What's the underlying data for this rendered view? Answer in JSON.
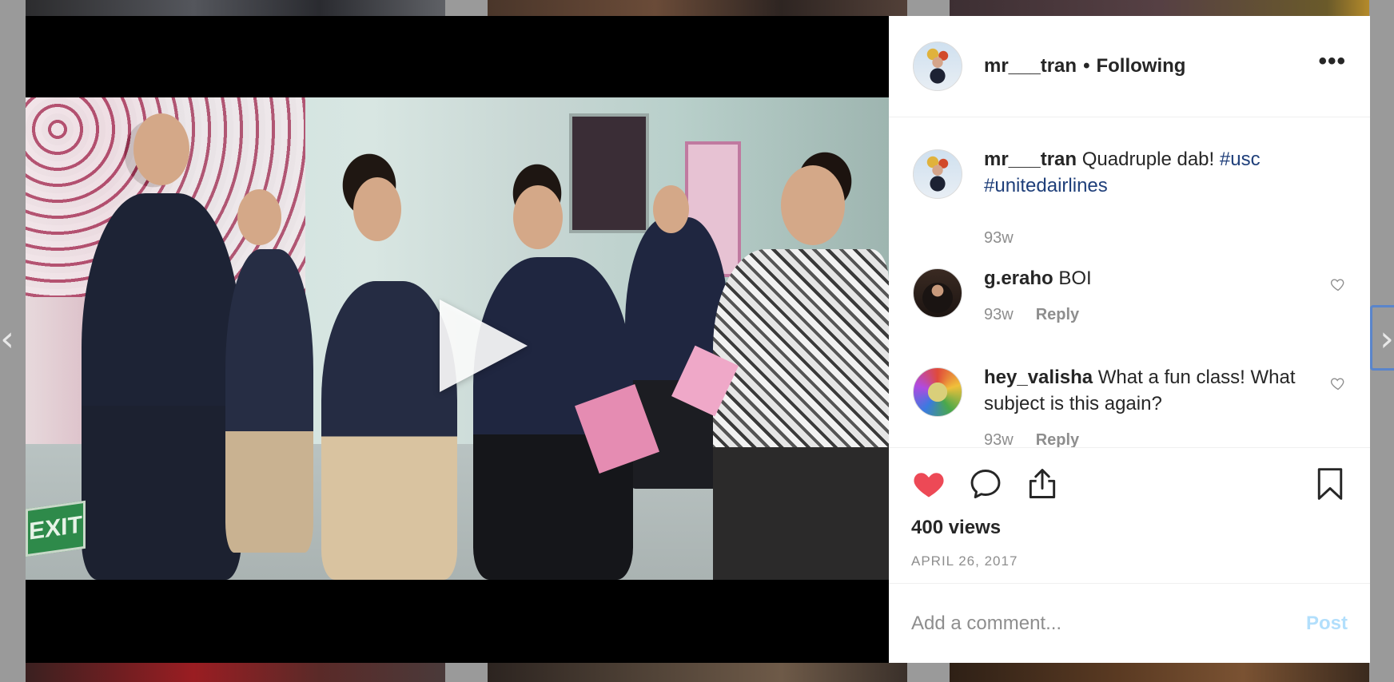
{
  "post": {
    "username": "mr___tran",
    "separator": "•",
    "follow_status": "Following",
    "more_icon": "more-options-icon",
    "more_label": "•••"
  },
  "comments": [
    {
      "username": "mr___tran",
      "text": "Quadruple dab!",
      "hashtags": [
        "#usc",
        "#unitedairlines"
      ],
      "time": "93w"
    },
    {
      "username": "g.eraho",
      "text": "BOI",
      "time": "93w",
      "reply_label": "Reply"
    },
    {
      "username": "hey_valisha",
      "text": "What a fun class! What subject is this again?",
      "time": "93w",
      "reply_label": "Reply"
    }
  ],
  "actions": {
    "like_icon": "heart-filled-icon",
    "comment_icon": "comment-icon",
    "share_icon": "share-icon",
    "save_icon": "bookmark-icon",
    "liked": true,
    "like_color": "#ed4956",
    "views": "400 views",
    "date": "APRIL 26, 2017"
  },
  "add_comment": {
    "placeholder": "Add a comment...",
    "post_label": "Post"
  },
  "media": {
    "play_icon": "play-icon",
    "exit_sign": "EXIT"
  },
  "colors": {
    "hashtag": "#1f3f7a",
    "muted": "#8e8e8e",
    "post_disabled": "#b2dffc"
  }
}
